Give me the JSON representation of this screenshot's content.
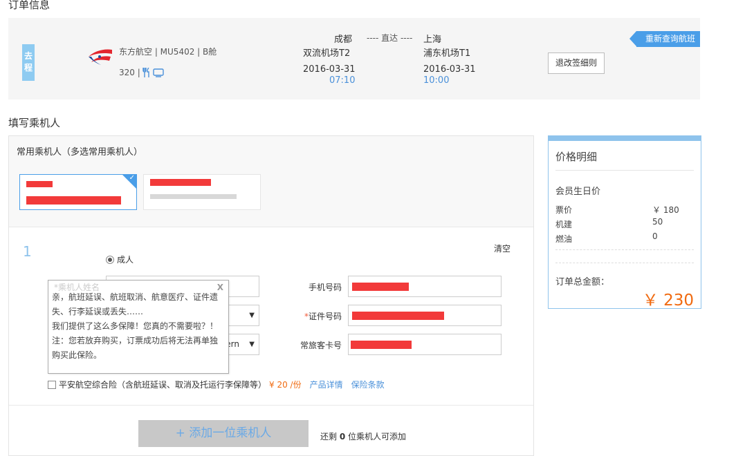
{
  "order": {
    "section_title": "订单信息",
    "trip_tag": "去程",
    "airline": "东方航空 | MU5402 | B舱",
    "aircraft": "320 |",
    "origin_city": "成都",
    "origin_airport": "双流机场T2",
    "direct": "---- 直达 ----",
    "dest_city": "上海",
    "dest_airport": "浦东机场T1",
    "depart_date": "2016-03-31",
    "depart_time": "07:10",
    "arrive_date": "2016-03-31",
    "arrive_time": "10:00",
    "rebook_label": "重新查询航班",
    "rules_label": "退改签细则",
    "colors": {
      "accent": "#4a9ee8",
      "tag": "#8ecbf1",
      "logo_red": "#e3262e",
      "logo_blue": "#1d4a9c"
    }
  },
  "passengers": {
    "section_title": "填写乘机人",
    "frequent_title": "常用乘机人（多选常用乘机人）",
    "index": "1",
    "type_label": "成人",
    "clear_label": "清空",
    "fields": {
      "phone_label": "手机号码",
      "id_label": "证件号码",
      "ff_label": "常旅客卡号",
      "select_value": "ern",
      "req_mark": "*"
    },
    "tooltip": {
      "ghost": "*乘机人姓名",
      "close": "X",
      "line1": "亲，航班延误、航班取消、航意医疗、证件遗失、行李延误或丢失……",
      "line2": "我们提供了这么多保障！您真的不需要啦？！",
      "line3": "注：您若放弃购买，订票成功后将无法再单独购买此保险。"
    },
    "insurance": {
      "label": "平安航空综合险（含航班延误、取消及托运行李保障等）",
      "price": "¥ 20 /份",
      "details_link": "产品详情",
      "terms_link": "保险条款"
    },
    "add_button": "+ 添加一位乘机人",
    "remain_prefix": "还剩",
    "remain_count": "0",
    "remain_suffix": "位乘机人可添加"
  },
  "price": {
    "title": "价格明细",
    "sub": "会员生日价",
    "rows": [
      {
        "label": "票价",
        "value": "￥ 180"
      },
      {
        "label": "机建",
        "value": "50"
      },
      {
        "label": "燃油",
        "value": "0"
      }
    ],
    "total_label": "订单总金额：",
    "total_value": "￥ 230"
  }
}
